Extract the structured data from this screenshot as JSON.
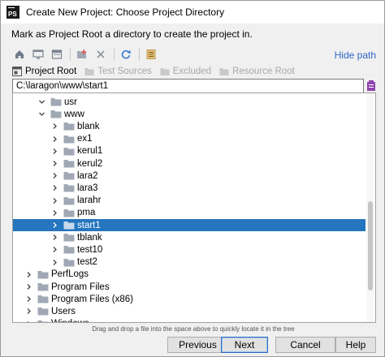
{
  "window": {
    "title": "Create New Project: Choose Project Directory"
  },
  "instruction": "Mark as Project Root a directory to create the project in.",
  "toolbar": {
    "icons": [
      "home-icon",
      "desktop-icon",
      "project-icon",
      "new-folder-icon",
      "delete-icon",
      "refresh-icon",
      "show-hidden-icon"
    ],
    "hide_path_label": "Hide path"
  },
  "roots": {
    "project_root": "Project Root",
    "test_sources": "Test Sources",
    "excluded": "Excluded",
    "resource_root": "Resource Root"
  },
  "path": {
    "value": "C:\\laragon\\www\\start1"
  },
  "tree": {
    "rows": [
      {
        "label": "usr",
        "indent": 2,
        "expanded": true,
        "selected": false
      },
      {
        "label": "www",
        "indent": 2,
        "expanded": true,
        "selected": false
      },
      {
        "label": "blank",
        "indent": 3,
        "expanded": false,
        "selected": false
      },
      {
        "label": "ex1",
        "indent": 3,
        "expanded": false,
        "selected": false
      },
      {
        "label": "kerul1",
        "indent": 3,
        "expanded": false,
        "selected": false
      },
      {
        "label": "kerul2",
        "indent": 3,
        "expanded": false,
        "selected": false
      },
      {
        "label": "lara2",
        "indent": 3,
        "expanded": false,
        "selected": false
      },
      {
        "label": "lara3",
        "indent": 3,
        "expanded": false,
        "selected": false
      },
      {
        "label": "larahr",
        "indent": 3,
        "expanded": false,
        "selected": false
      },
      {
        "label": "pma",
        "indent": 3,
        "expanded": false,
        "selected": false
      },
      {
        "label": "start1",
        "indent": 3,
        "expanded": false,
        "selected": true
      },
      {
        "label": "tblank",
        "indent": 3,
        "expanded": false,
        "selected": false
      },
      {
        "label": "test10",
        "indent": 3,
        "expanded": false,
        "selected": false
      },
      {
        "label": "test2",
        "indent": 3,
        "expanded": false,
        "selected": false
      },
      {
        "label": "PerfLogs",
        "indent": 1,
        "expanded": false,
        "selected": false
      },
      {
        "label": "Program Files",
        "indent": 1,
        "expanded": false,
        "selected": false
      },
      {
        "label": "Program Files (x86)",
        "indent": 1,
        "expanded": false,
        "selected": false
      },
      {
        "label": "Users",
        "indent": 1,
        "expanded": false,
        "selected": false
      },
      {
        "label": "Windows",
        "indent": 1,
        "expanded": false,
        "selected": false
      }
    ]
  },
  "drag_hint": "Drag and drop a file into the space above to quickly locate it in the tree",
  "buttons": {
    "previous": "Previous",
    "next": "Next",
    "cancel": "Cancel",
    "help": "Help"
  },
  "colors": {
    "selection": "#2675bf",
    "link": "#2f65ca",
    "folder": "#a0a8b4",
    "accent_purple": "#8e44ad"
  }
}
